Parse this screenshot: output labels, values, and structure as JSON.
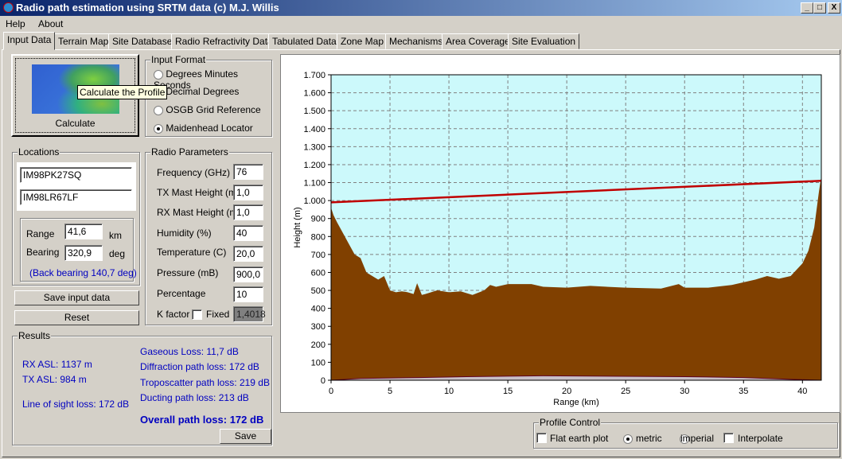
{
  "window": {
    "title": "Radio path estimation using SRTM data (c) M.J. Willis",
    "controls": [
      "_",
      "□",
      "X"
    ]
  },
  "menu": [
    "Help",
    "About"
  ],
  "tabs": [
    "Input Data",
    "Terrain Map",
    "Site Database",
    "Radio Refractivity Data",
    "Tabulated Data",
    "Zone Map",
    "Mechanisms",
    "Area Coverage",
    "Site Evaluation"
  ],
  "calculate": {
    "label": "Calculate",
    "tooltip": "Calculate the Profile"
  },
  "input_format": {
    "title": "Input Format",
    "options": [
      "Degrees Minutes Seconds",
      "Decimal Degrees",
      "OSGB Grid Reference",
      "Maidenhead Locator"
    ],
    "selected": "Maidenhead Locator"
  },
  "locations": {
    "title": "Locations",
    "tx": "IM98PK27SQ",
    "rx": "IM98LR67LF",
    "range_label": "Range",
    "range": "41,6",
    "range_unit": "km",
    "bearing_label": "Bearing",
    "bearing": "320,9",
    "bearing_unit": "deg",
    "back_bearing": "(Back bearing 140,7 deg)"
  },
  "buttons": {
    "save_input": "Save input data",
    "reset": "Reset",
    "save": "Save"
  },
  "radio": {
    "title": "Radio Parameters",
    "params": [
      {
        "label": "Frequency (GHz)",
        "value": "76"
      },
      {
        "label": "TX Mast Height (m)",
        "value": "1,0"
      },
      {
        "label": "RX Mast Height (m)",
        "value": "1,0"
      },
      {
        "label": "Humidity (%)",
        "value": "40"
      },
      {
        "label": "Temperature (C)",
        "value": "20,0"
      },
      {
        "label": "Pressure (mB)",
        "value": "900,0"
      },
      {
        "label": "Percentage",
        "value": "10"
      }
    ],
    "k_label": "K factor",
    "fixed_label": "Fixed",
    "fixed": false,
    "k_value": "1,4018"
  },
  "results": {
    "title": "Results",
    "rx_asl": "RX ASL: 1137 m",
    "tx_asl": "TX ASL: 984 m",
    "los": "Line of sight loss: 172 dB",
    "gaseous": "Gaseous Loss: 11,7 dB",
    "diffraction": "Diffraction path loss: 172 dB",
    "troposcatter": "Troposcatter path loss: 219 dB",
    "ducting": "Ducting path loss: 213 dB",
    "overall": "Overall path loss: 172 dB"
  },
  "profile_control": {
    "title": "Profile Control",
    "flat_earth": "Flat earth plot",
    "flat_earth_checked": false,
    "metric": "metric",
    "imperial": "imperial",
    "units": "metric",
    "interpolate": "Interpolate",
    "interpolate_checked": false
  },
  "colors": {
    "sky": "#ccf9fb",
    "terrain": "#804000",
    "los": "#c00000",
    "title_start": "#0a246a",
    "result_text": "#0000c0"
  },
  "chart_data": {
    "type": "area",
    "xlabel": "Range (km)",
    "ylabel": "Height (m)",
    "xlim": [
      0,
      41.6
    ],
    "ylim": [
      0,
      1700
    ],
    "xticks": [
      0,
      5,
      10,
      15,
      20,
      25,
      30,
      35,
      40
    ],
    "yticks": [
      "0",
      "100",
      "200",
      "300",
      "400",
      "500",
      "600",
      "700",
      "800",
      "900",
      "1.000",
      "1.100",
      "1.200",
      "1.300",
      "1.400",
      "1.500",
      "1.600",
      "1.700"
    ],
    "grid": true,
    "terrain": {
      "x": [
        0,
        0.2,
        0.5,
        1,
        1.5,
        2,
        2.5,
        3,
        3.5,
        4,
        4.5,
        5,
        5.5,
        6,
        6.5,
        7,
        7.3,
        7.7,
        8,
        9,
        10,
        11,
        12,
        13,
        13.5,
        14,
        15,
        17,
        18,
        20,
        22,
        25,
        28,
        29.5,
        30,
        32,
        34,
        35,
        36,
        37,
        38,
        39,
        40,
        40.5,
        41,
        41.4,
        41.6
      ],
      "y": [
        960,
        920,
        880,
        820,
        760,
        700,
        680,
        600,
        580,
        560,
        580,
        500,
        490,
        495,
        490,
        480,
        540,
        475,
        480,
        500,
        490,
        495,
        475,
        500,
        530,
        520,
        535,
        535,
        520,
        515,
        525,
        515,
        510,
        535,
        515,
        515,
        530,
        545,
        560,
        580,
        565,
        580,
        650,
        720,
        850,
        1050,
        1137
      ]
    },
    "line_of_sight": {
      "x": [
        0,
        41.6
      ],
      "y": [
        990,
        1110
      ]
    },
    "earth_curvature": {
      "x": [
        0,
        2.5,
        7.5,
        11.5,
        18,
        30,
        35,
        39,
        41.6
      ],
      "y": [
        0,
        10,
        15,
        20,
        25,
        20,
        15,
        5,
        0
      ]
    }
  }
}
